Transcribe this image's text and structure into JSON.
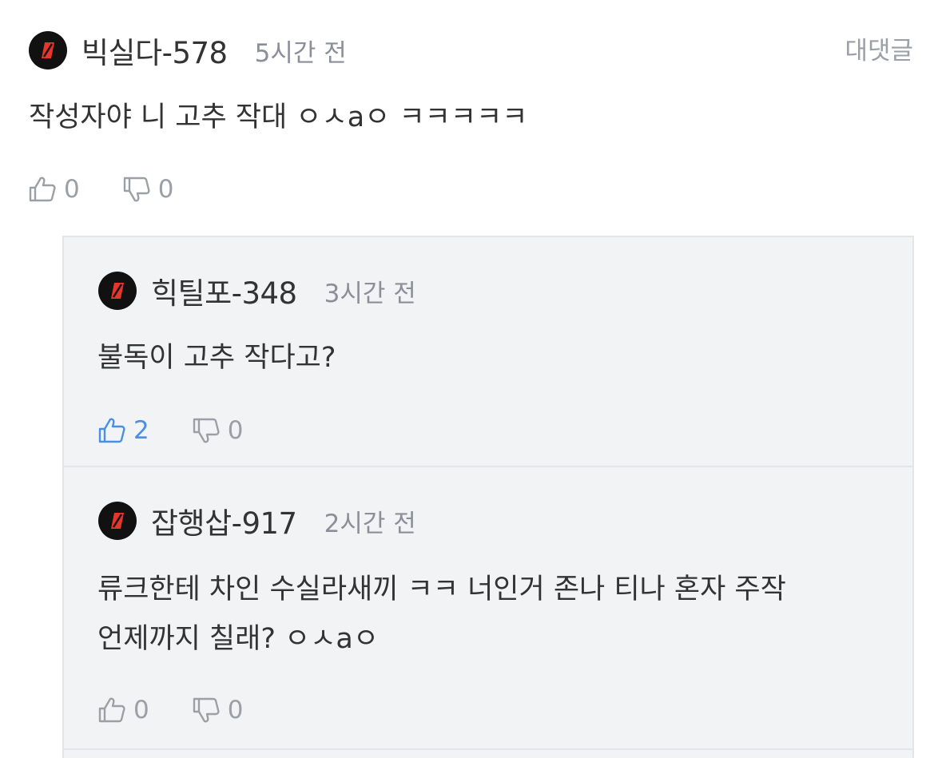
{
  "comment": {
    "username": "빅실다-578",
    "time": "5시간 전",
    "reply_label": "대댓글",
    "text": "작성자야 니 고추 작대 ㅇㅅaㅇ ㅋㅋㅋㅋㅋ",
    "likes": "0",
    "dislikes": "0"
  },
  "replies": [
    {
      "username": "힉틸포-348",
      "time": "3시간 전",
      "text": "불독이 고추 작다고?",
      "likes": "2",
      "dislikes": "0",
      "liked": true
    },
    {
      "username": "잡행삽-917",
      "time": "2시간 전",
      "text_line1": "류크한테 차인 수실라새끼 ㅋㅋ 너인거 존나 티나 혼자 주작",
      "text_line2": "언제까지 칠래? ㅇㅅaㅇ",
      "likes": "0",
      "dislikes": "0",
      "liked": false
    }
  ],
  "colors": {
    "accent": "#4a90e2",
    "muted": "#9aa0a6",
    "reply_bg": "#f2f3f5",
    "avatar_bg": "#111111",
    "avatar_mark": "#e8352b"
  },
  "icons": {
    "avatar": "red-slash-logo-icon",
    "like": "thumbs-up-icon",
    "dislike": "thumbs-down-icon"
  }
}
